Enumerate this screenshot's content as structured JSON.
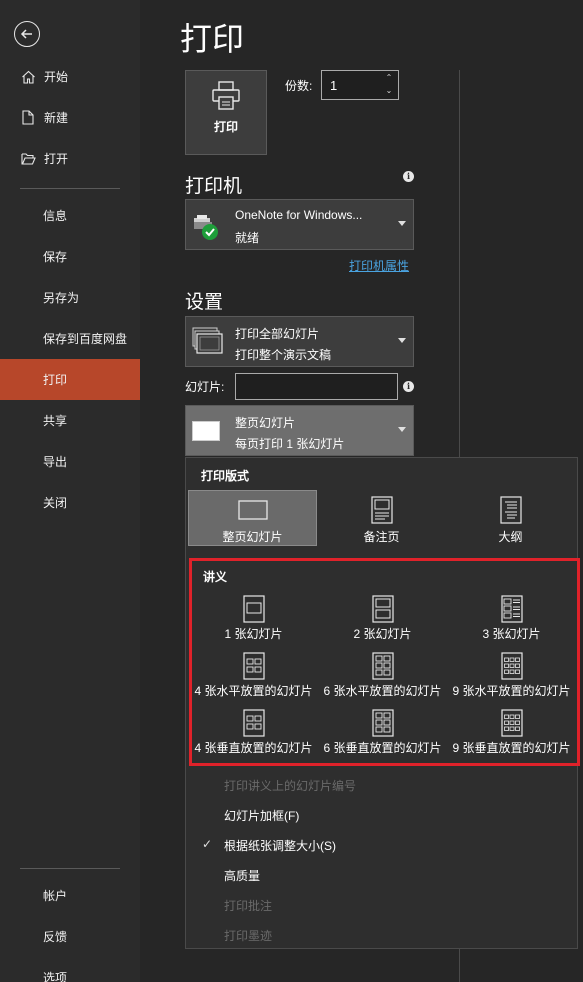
{
  "sidebar": {
    "back_icon": "back-arrow-icon",
    "items": [
      {
        "label": "开始",
        "icon": "home-icon"
      },
      {
        "label": "新建",
        "icon": "new-document-icon"
      },
      {
        "label": "打开",
        "icon": "folder-open-icon"
      },
      {
        "label": "信息"
      },
      {
        "label": "保存"
      },
      {
        "label": "另存为"
      },
      {
        "label": "保存到百度网盘"
      },
      {
        "label": "打印",
        "active": true
      },
      {
        "label": "共享"
      },
      {
        "label": "导出"
      },
      {
        "label": "关闭"
      },
      {
        "label": "帐户"
      },
      {
        "label": "反馈"
      },
      {
        "label": "选项"
      }
    ],
    "active_color": "#b7472a"
  },
  "main": {
    "title": "打印",
    "print_button": "打印",
    "copies_label": "份数:",
    "copies_value": "1",
    "printer_heading": "打印机",
    "printer_name": "OneNote for Windows...",
    "printer_status": "就绪",
    "printer_properties": "打印机属性",
    "settings_heading": "设置",
    "range_line1": "打印全部幻灯片",
    "range_line2": "打印整个演示文稿",
    "slides_label": "幻灯片:",
    "slides_value": "",
    "layout_line1": "整页幻灯片",
    "layout_line2": "每页打印 1 张幻灯片"
  },
  "flyout": {
    "layout_heading": "打印版式",
    "layouts": [
      {
        "label": "整页幻灯片",
        "selected": true
      },
      {
        "label": "备注页"
      },
      {
        "label": "大纲"
      }
    ],
    "handout_heading": "讲义",
    "handouts": [
      "1 张幻灯片",
      "2 张幻灯片",
      "3 张幻灯片",
      "4 张水平放置的幻灯片",
      "6 张水平放置的幻灯片",
      "9 张水平放置的幻灯片",
      "4 张垂直放置的幻灯片",
      "6 张垂直放置的幻灯片",
      "9 张垂直放置的幻灯片"
    ],
    "options": [
      {
        "label": "打印讲义上的幻灯片编号",
        "disabled": true
      },
      {
        "label": "幻灯片加框(F)"
      },
      {
        "label": "根据纸张调整大小(S)",
        "checked": true
      },
      {
        "label": "高质量"
      },
      {
        "label": "打印批注",
        "disabled": true
      },
      {
        "label": "打印墨迹",
        "disabled": true
      }
    ],
    "highlight_color": "#e0222a"
  }
}
